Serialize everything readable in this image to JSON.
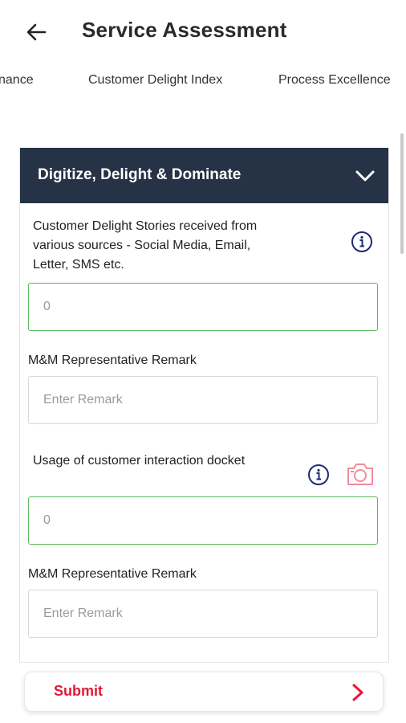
{
  "header": {
    "back_icon": "arrow-left-icon",
    "title": "Service Assessment"
  },
  "tabs": [
    {
      "label": "nance"
    },
    {
      "label": "Customer Delight Index"
    },
    {
      "label": "Process Excellence"
    }
  ],
  "section": {
    "title": "Digitize, Delight & Dominate",
    "expanded_icon": "chevron-down-icon",
    "header_color": "#263245"
  },
  "questions": [
    {
      "text": "Customer Delight Stories received from various sources - Social Media, Email, Letter, SMS etc.",
      "value_placeholder": "0",
      "info_icon": "info-icon",
      "remark_label": "M&M Representative Remark",
      "remark_placeholder": "Enter Remark"
    },
    {
      "text": "Usage of customer interaction docket",
      "value_placeholder": "0",
      "info_icon": "info-icon",
      "camera_icon": "camera-icon",
      "remark_label": "M&M Representative Remark",
      "remark_placeholder": "Enter Remark"
    }
  ],
  "footer": {
    "submit_label": "Submit",
    "arrow_icon": "chevron-right-icon",
    "accent_color": "#e31837"
  },
  "colors": {
    "valid_border": "#5cb85c",
    "info_icon": "#1f2a7a",
    "camera_icon": "#f28b9b"
  }
}
